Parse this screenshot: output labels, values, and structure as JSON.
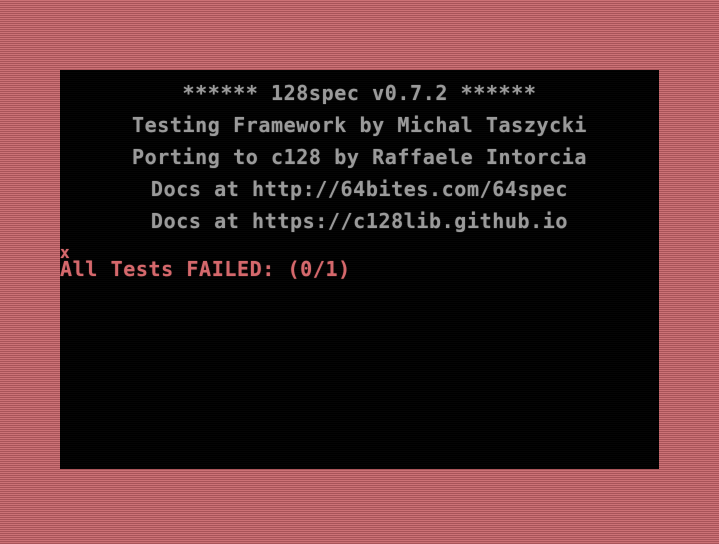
{
  "colors": {
    "border": "#c46a6e",
    "screen_background": "#000000",
    "text_grey": "#9a9a9a",
    "text_red": "#d5686c"
  },
  "header": {
    "title_line": "****** 128spec v0.7.2 ******",
    "credit_line_1": "Testing Framework by Michal Taszycki",
    "credit_line_2": "Porting to c128 by Raffaele Intorcia",
    "docs_line_1": "Docs at http://64bites.com/64spec",
    "docs_line_2": "Docs at https://c128lib.github.io"
  },
  "results": {
    "progress_marks": "x",
    "summary": "All Tests FAILED: (0/1)"
  }
}
